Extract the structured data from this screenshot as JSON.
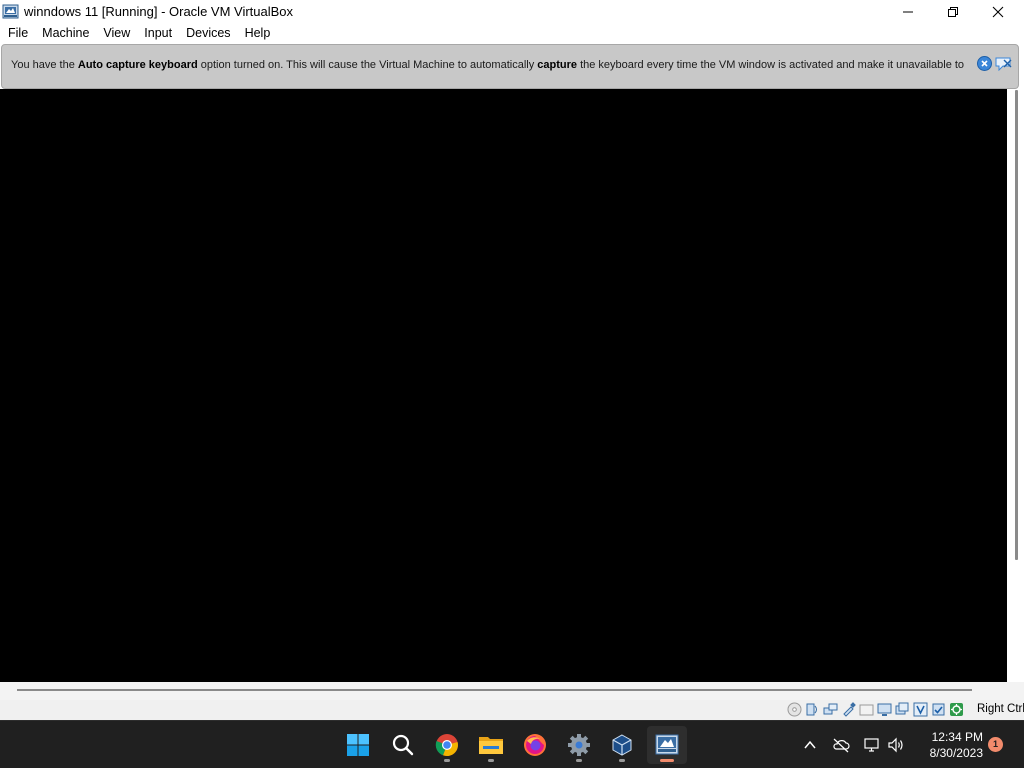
{
  "window": {
    "title": "winndows 11 [Running] - Oracle VM VirtualBox",
    "controls": {
      "minimize": "minimize-icon",
      "maximize": "maximize-icon",
      "close": "close-icon"
    }
  },
  "menubar": {
    "items": [
      {
        "label": "File"
      },
      {
        "label": "Machine"
      },
      {
        "label": "View"
      },
      {
        "label": "Input"
      },
      {
        "label": "Devices"
      },
      {
        "label": "Help"
      }
    ]
  },
  "notification": {
    "part1": "You have the ",
    "bold1": "Auto capture keyboard",
    "part2": " option turned on. This will cause the Virtual Machine to automatically ",
    "bold2": "capture",
    "part3": " the keyboard every time the VM window is activated and make it unavailable to"
  },
  "statusbar": {
    "icons": [
      "optical-drive-icon",
      "audio-icon",
      "network-icon",
      "usb-icon",
      "shared-folders-icon",
      "display-icon",
      "recording-icon",
      "virtualization-icon",
      "cpu-icon",
      "mouse-integration-icon"
    ],
    "host_key": "Right Ctrl"
  },
  "taskbar": {
    "apps": [
      "windows-start-icon",
      "search-icon",
      "chrome-icon",
      "file-explorer-icon",
      "firefox-icon",
      "settings-icon",
      "virtualbox-icon",
      "virtualbox-vm-icon"
    ],
    "tray": {
      "icons": [
        "show-hidden-icons-chevron",
        "cloud-offline-icon",
        "network-icon",
        "volume-icon"
      ],
      "time": "12:34 PM",
      "date": "8/30/2023",
      "notification_count": "1"
    }
  },
  "colors": {
    "vm_screen": "#000000",
    "notice_bg": "#c8c8c8",
    "taskbar_bg": "#202020",
    "accent": "#f28b6c"
  }
}
